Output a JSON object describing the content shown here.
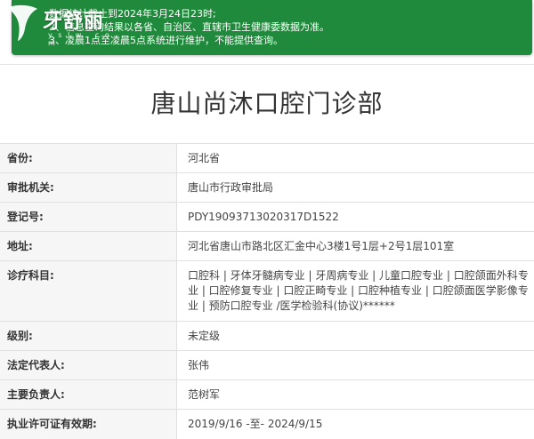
{
  "watermark": {
    "text": "牙舒丽",
    "sub": "y s l w . c o m"
  },
  "notice": {
    "line1": "数据统计截止到2024年3月24日23时;",
    "line2": "2、信息查询结果以各省、自治区、直辖市卫生健康委数据为准。",
    "line3": "3、凌晨1点至凌晨5点系统进行维护，不能提供查询。"
  },
  "clinic": {
    "name": "唐山尚沐口腔门诊部"
  },
  "fields": [
    {
      "label": "省份:",
      "value": "河北省"
    },
    {
      "label": "审批机关:",
      "value": "唐山市行政审批局"
    },
    {
      "label": "登记号:",
      "value": "PDY19093713020317D1522"
    },
    {
      "label": "地址:",
      "value": "河北省唐山市路北区汇金中心3楼1号1层+2号1层101室"
    },
    {
      "label": "诊疗科目:",
      "value": "口腔科 | 牙体牙髓病专业 | 牙周病专业 | 儿童口腔专业 | 口腔颌面外科专业 | 口腔修复专业 | 口腔正畸专业 | 口腔种植专业 | 口腔颌面医学影像专业 | 预防口腔专业 /医学检验科(协议)******"
    },
    {
      "label": "级别:",
      "value": "未定级"
    },
    {
      "label": "法定代表人:",
      "value": "张伟"
    },
    {
      "label": "主要负责人:",
      "value": "范树军"
    },
    {
      "label": "执业许可证有效期:",
      "value": "2019/9/16 -至- 2024/9/15"
    }
  ],
  "colors": {
    "notice_bg": "#1f8a3b",
    "label_bg": "#f6f6f6",
    "border": "#e0e0e0"
  }
}
